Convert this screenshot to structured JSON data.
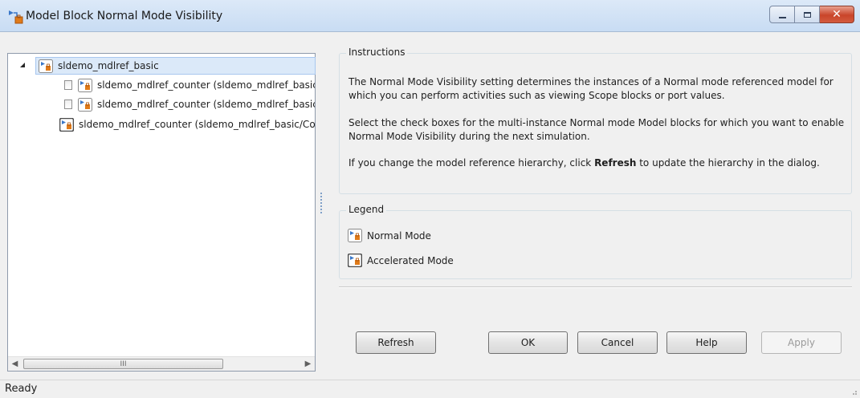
{
  "window": {
    "title": "Model Block Normal Mode Visibility",
    "close_glyph": "✕"
  },
  "tree": {
    "root": {
      "label": "sldemo_mdlref_basic",
      "icon": "normal-mode-model-icon"
    },
    "children": [
      {
        "label": "sldemo_mdlref_counter (sldemo_mdlref_basic/CounterA)",
        "checked": false,
        "icon": "normal-mode-model-icon"
      },
      {
        "label": "sldemo_mdlref_counter (sldemo_mdlref_basic/CounterB)",
        "checked": false,
        "icon": "normal-mode-model-icon"
      },
      {
        "label": "sldemo_mdlref_counter (sldemo_mdlref_basic/CounterC)",
        "icon": "accelerated-mode-model-icon"
      }
    ],
    "scroll_thumb_glyph": "III",
    "scroll_left": "◀",
    "scroll_right": "▶"
  },
  "instructions": {
    "title": "Instructions",
    "p1": "The Normal Mode Visibility setting determines the instances of a Normal mode referenced model for which you can perform activities such as viewing Scope blocks or port values.",
    "p2": "Select the check boxes for the multi-instance Normal mode Model blocks for which you want to enable Normal Mode Visibility during the next simulation.",
    "p3_before": "If you change the model reference hierarchy, click ",
    "p3_bold": "Refresh",
    "p3_after": " to update the hierarchy in the dialog."
  },
  "legend": {
    "title": "Legend",
    "items": [
      {
        "label": "Normal Mode",
        "icon": "normal-mode-icon"
      },
      {
        "label": "Accelerated Mode",
        "icon": "accelerated-mode-icon"
      }
    ]
  },
  "buttons": {
    "refresh": "Refresh",
    "ok": "OK",
    "cancel": "Cancel",
    "help": "Help",
    "apply": "Apply",
    "apply_enabled": false
  },
  "status": {
    "text": "Ready"
  },
  "colors": {
    "title_bar": "#c8dcf3",
    "selected_row": "#dbe9f9",
    "close_button": "#c9452a",
    "icon_blue": "#3a78c9",
    "icon_orange": "#e07b1a"
  }
}
